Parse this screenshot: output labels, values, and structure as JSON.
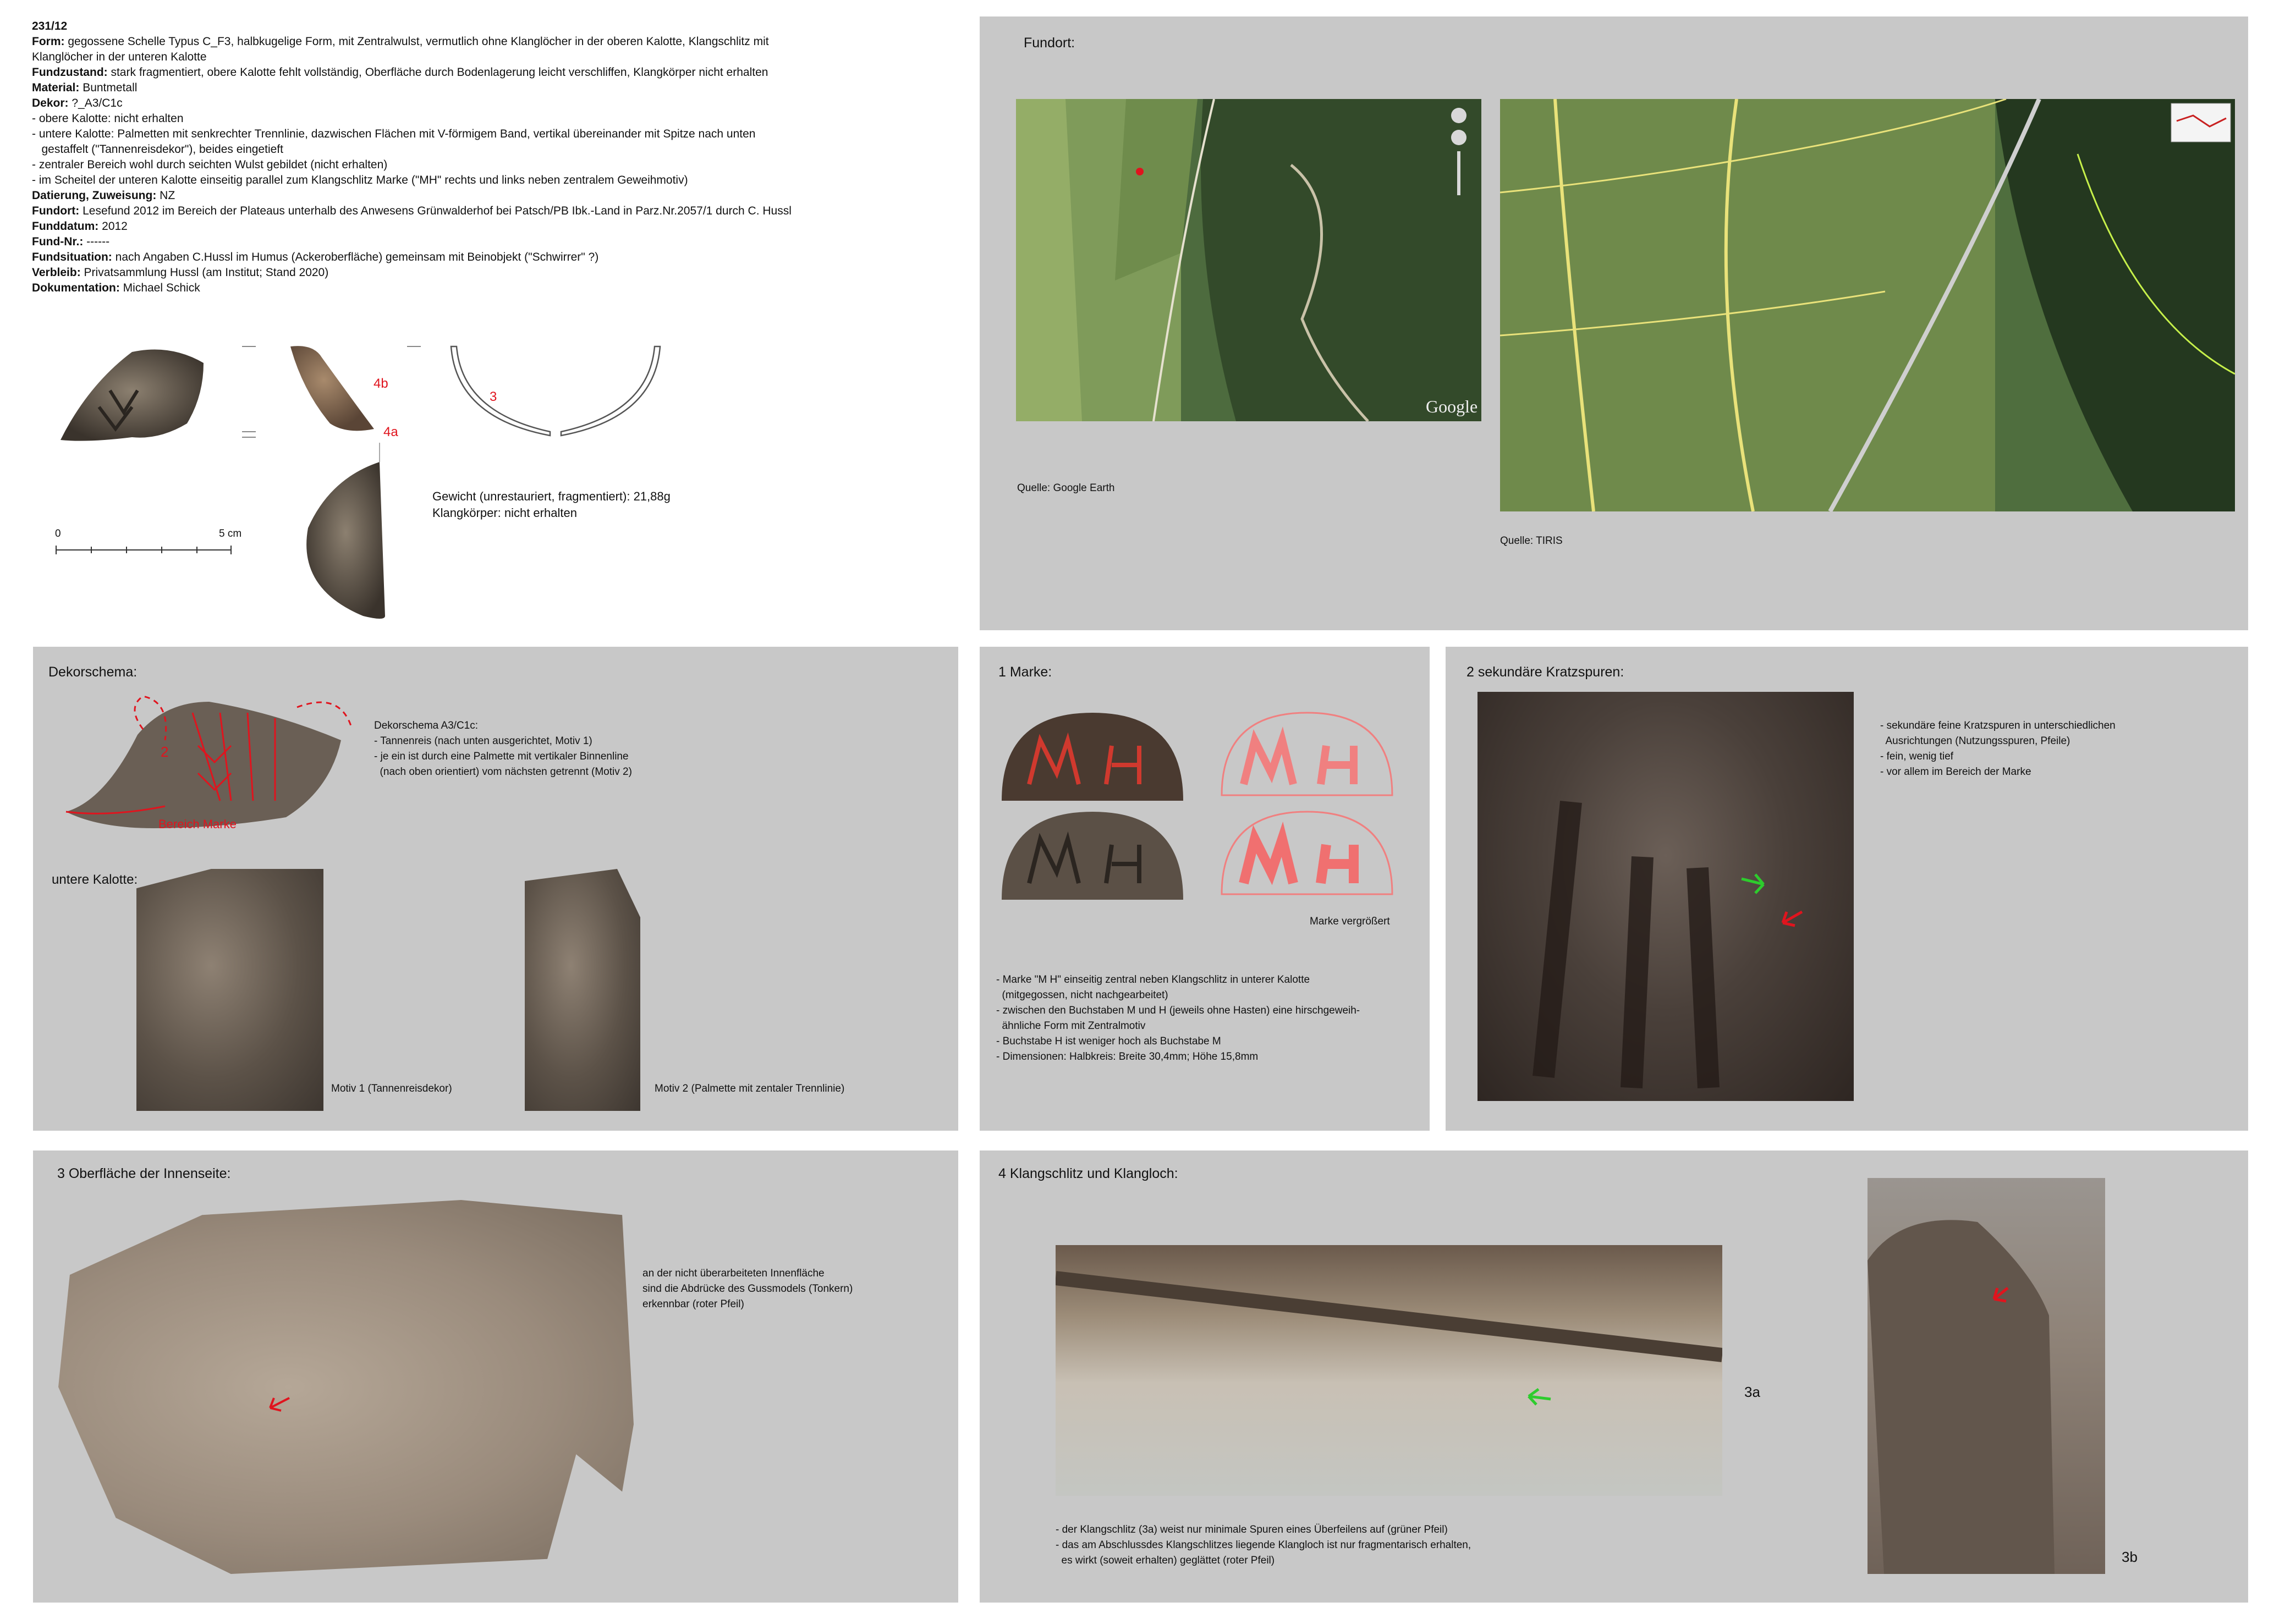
{
  "record": {
    "id": "231/12",
    "rows": [
      {
        "k": "Form:",
        "v": " gegossene Schelle Typus C_F3, halbkugelige Form, mit Zentralwulst, vermutlich ohne Klanglöcher in der oberen Kalotte, Klangschlitz mit"
      },
      {
        "k": "",
        "v": "Klanglöcher in der unteren Kalotte"
      },
      {
        "k": "Fundzustand:",
        "v": " stark fragmentiert, obere Kalotte fehlt vollständig, Oberfläche durch Bodenlagerung leicht verschliffen, Klangkörper nicht erhalten"
      },
      {
        "k": "Material:",
        "v": " Buntmetall"
      },
      {
        "k": "Dekor:",
        "v": " ?_A3/C1c"
      },
      {
        "k": "",
        "v": "- obere Kalotte: nicht erhalten"
      },
      {
        "k": "",
        "v": "- untere Kalotte: Palmetten mit senkrechter Trennlinie, dazwischen Flächen mit V-förmigem Band, vertikal übereinander mit Spitze nach unten"
      },
      {
        "k": "",
        "v": "   gestaffelt (\"Tannenreisdekor\"), beides eingetieft"
      },
      {
        "k": "",
        "v": "- zentraler Bereich wohl durch seichten Wulst gebildet (nicht erhalten)"
      },
      {
        "k": "",
        "v": "- im Scheitel der unteren Kalotte einseitig parallel zum Klangschlitz Marke (\"MH\" rechts und links neben zentralem Geweihmotiv)"
      },
      {
        "k": "Datierung, Zuweisung:",
        "v": " NZ"
      },
      {
        "k": "Fundort:",
        "v": " Lesefund 2012 im Bereich der Plateaus unterhalb des Anwesens Grünwalderhof bei Patsch/PB Ibk.-Land in Parz.Nr.2057/1 durch C. Hussl"
      },
      {
        "k": "Funddatum:",
        "v": " 2012"
      },
      {
        "k": "Fund-Nr.:",
        "v": " ------"
      },
      {
        "k": "Fundsituation:",
        "v": " nach Angaben C.Hussl im Humus (Ackeroberfläche) gemeinsam mit Beinobjekt (\"Schwirrer\" ?)"
      },
      {
        "k": "Verbleib:",
        "v": " Privatsammlung Hussl (am Institut; Stand 2020)"
      },
      {
        "k": "Dokumentation:",
        "v": " Michael Schick"
      }
    ]
  },
  "drawing": {
    "labels": [
      "4b",
      "4a",
      "3"
    ],
    "scale": {
      "start": "0",
      "end": "5 cm"
    },
    "weight": "Gewicht (unrestauriert, fragmentiert): 21,88g",
    "body": "Klangkörper: nicht erhalten"
  },
  "fundort": {
    "title": "Fundort:",
    "source1": "Quelle: Google Earth",
    "source2": "Quelle: TIRIS",
    "google_logo": "Google"
  },
  "dekor": {
    "title": "Dekorschema:",
    "label_2": "2",
    "label_bereich": "Bereich Marke",
    "caption": [
      "Dekorschema A3/C1c:",
      "- Tannenreis (nach unten ausgerichtet, Motiv 1)",
      "- je ein ist durch eine Palmette mit vertikaler Binnenline",
      "  (nach oben orientiert) vom nächsten getrennt (Motiv 2)"
    ],
    "subtitle": "untere Kalotte:",
    "motiv1": "Motiv 1 (Tannenreisdekor)",
    "motiv2": "Motiv 2 (Palmette mit zentaler Trennlinie)"
  },
  "marke": {
    "title": "1 Marke:",
    "enlarged": "Marke vergrößert",
    "caption": [
      "- Marke \"M H\" einseitig zentral neben Klangschlitz in unterer Kalotte",
      "  (mitgegossen, nicht nachgearbeitet)",
      "- zwischen den Buchstaben M und H (jeweils ohne Hasten) eine hirschgeweih-",
      "  ähnliche Form mit Zentralmotiv",
      "- Buchstabe H ist weniger hoch als Buchstabe M",
      "- Dimensionen: Halbkreis: Breite 30,4mm; Höhe 15,8mm"
    ]
  },
  "kratz": {
    "title": "2 sekundäre Kratzspuren:",
    "caption": [
      "- sekundäre feine Kratzspuren in unterschiedlichen",
      "  Ausrichtungen (Nutzungsspuren, Pfeile)",
      "- fein, wenig tief",
      "- vor allem im Bereich der Marke"
    ]
  },
  "innen": {
    "title": "3 Oberfläche der Innenseite:",
    "caption": [
      "an der nicht überarbeiteten Innenfläche",
      "sind die Abdrücke des Gussmodels (Tonkern)",
      "erkennbar (roter Pfeil)"
    ]
  },
  "klang": {
    "title": "4 Klangschlitz und Klangloch:",
    "label_3a": "3a",
    "label_3b": "3b",
    "caption": [
      "- der Klangschlitz (3a) weist nur minimale Spuren eines Überfeilens auf (grüner Pfeil)",
      "- das am Abschlussdes Klangschlitzes liegende Klangloch ist nur fragmentarisch erhalten,",
      "  es wirkt (soweit erhalten) geglättet (roter Pfeil)"
    ]
  },
  "colors": {
    "panel": "#c8c8c8",
    "red": "#e0141e",
    "green": "#2dcc2d",
    "tiris_line": "#e9e27a"
  }
}
